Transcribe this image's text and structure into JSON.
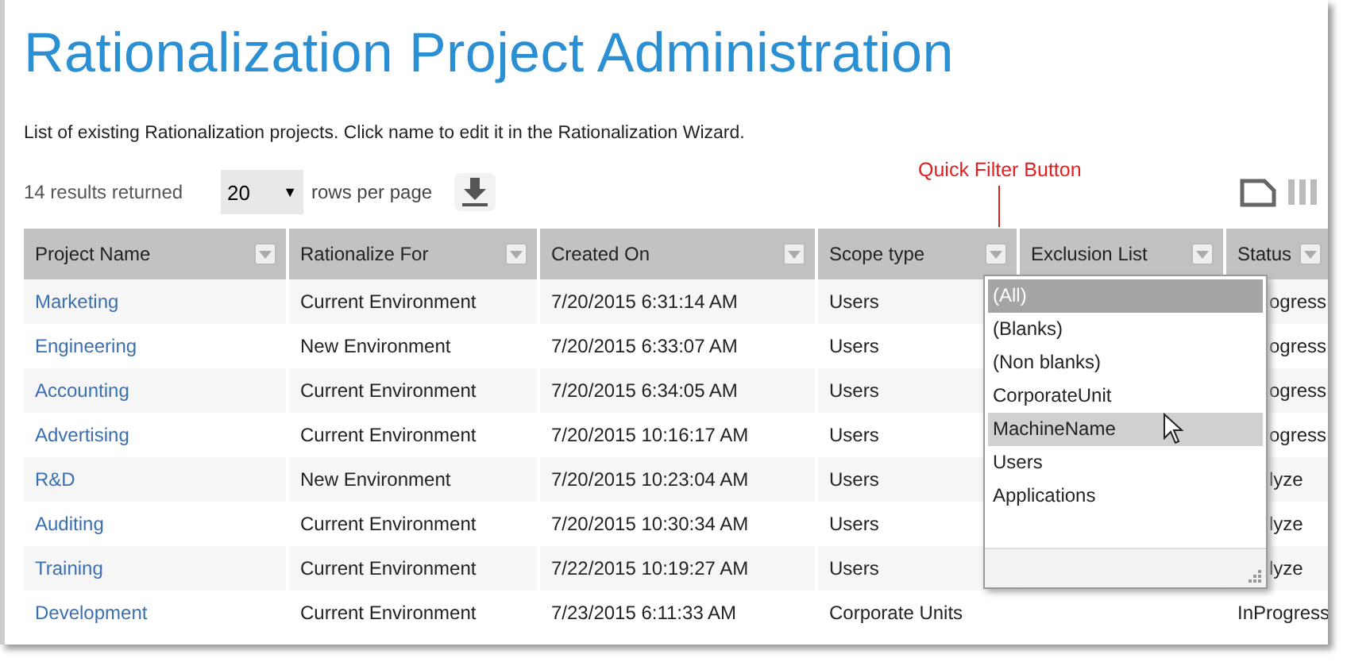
{
  "title": "Rationalization Project Administration",
  "description": "List of existing Rationalization projects. Click name to edit it in the Rationalization Wizard.",
  "toolbar": {
    "results": "14 results returned",
    "page_size": "20",
    "page_size_caret": "▼",
    "rows_label": "rows per page"
  },
  "annotation": {
    "text": "Quick Filter Button"
  },
  "table": {
    "columns": [
      {
        "label": "Project Name",
        "filter": true
      },
      {
        "label": "Rationalize For",
        "filter": true
      },
      {
        "label": "Created On",
        "filter": true
      },
      {
        "label": "Scope type",
        "filter": true
      },
      {
        "label": "Exclusion List",
        "filter": true
      },
      {
        "label": "Status",
        "filter": true
      }
    ],
    "rows": [
      {
        "name": "Marketing",
        "for": "Current Environment",
        "created": "7/20/2015 6:31:14 AM",
        "scope": "Users",
        "status": "ogress"
      },
      {
        "name": "Engineering",
        "for": "New Environment",
        "created": "7/20/2015 6:33:07 AM",
        "scope": "Users",
        "status": "ogress"
      },
      {
        "name": "Accounting",
        "for": "Current Environment",
        "created": "7/20/2015 6:34:05 AM",
        "scope": "Users",
        "status": "ogress"
      },
      {
        "name": "Advertising",
        "for": "Current Environment",
        "created": "7/20/2015 10:16:17 AM",
        "scope": "Users",
        "status": "ogress"
      },
      {
        "name": "R&D",
        "for": "New Environment",
        "created": "7/20/2015 10:23:04 AM",
        "scope": "Users",
        "status": "lyze"
      },
      {
        "name": "Auditing",
        "for": "Current Environment",
        "created": "7/20/2015 10:30:34 AM",
        "scope": "Users",
        "status": "lyze"
      },
      {
        "name": "Training",
        "for": "Current Environment",
        "created": "7/22/2015 10:19:27 AM",
        "scope": "Users",
        "status": "lyze"
      },
      {
        "name": "Development",
        "for": "Current Environment",
        "created": "7/23/2015 6:11:33 AM",
        "scope": "Corporate Units",
        "status": "InProgress"
      }
    ]
  },
  "filter_dropdown": {
    "items": [
      {
        "label": "(All)",
        "selected": true,
        "hovered": false
      },
      {
        "label": "(Blanks)",
        "selected": false,
        "hovered": false
      },
      {
        "label": "(Non blanks)",
        "selected": false,
        "hovered": false
      },
      {
        "label": "CorporateUnit",
        "selected": false,
        "hovered": false
      },
      {
        "label": "MachineName",
        "selected": false,
        "hovered": true
      },
      {
        "label": "Users",
        "selected": false,
        "hovered": false
      },
      {
        "label": "Applications",
        "selected": false,
        "hovered": false
      }
    ]
  }
}
